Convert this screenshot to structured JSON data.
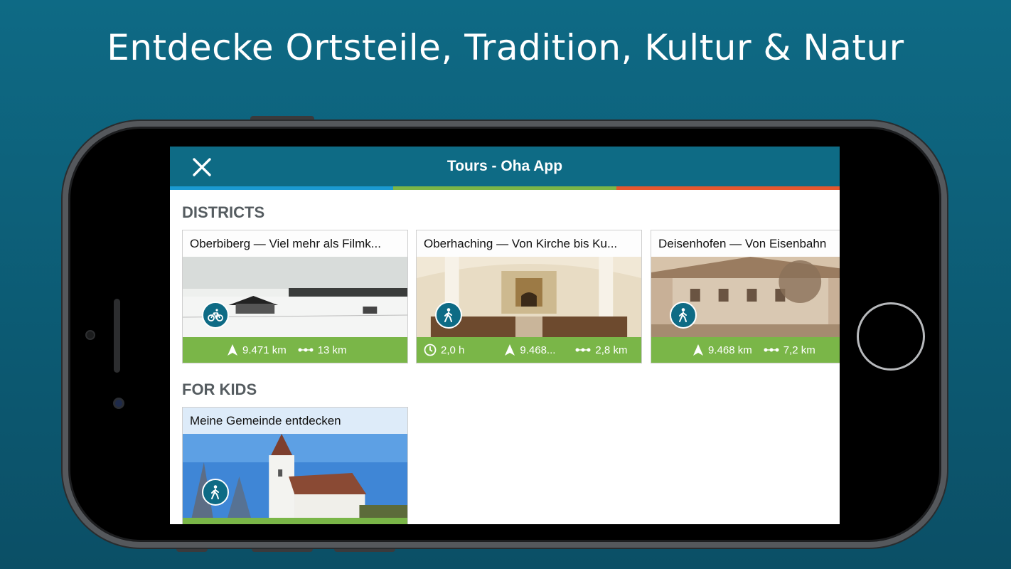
{
  "headline": "Entdecke Ortsteile, Tradition, Kultur & Natur",
  "appbar": {
    "title": "Tours - Oha App",
    "close_icon": "close-icon",
    "stripe_colors": [
      "#1b9ad1",
      "#7ab648",
      "#e4572e"
    ]
  },
  "colors": {
    "background": "#0b5e79",
    "appbar": "#0e6b85",
    "footer_green": "#7ab648"
  },
  "sections": {
    "districts": {
      "title": "DISTRICTS",
      "cards": [
        {
          "title": "Oberbiberg — Viel mehr als Filmk...",
          "mode_icon": "bicycle-icon",
          "elevation": "9.471 km",
          "distance": "13 km"
        },
        {
          "title": "Oberhaching — Von Kirche bis Ku...",
          "mode_icon": "walking-icon",
          "duration": "2,0 h",
          "elevation": "9.468...",
          "distance": "2,8 km"
        },
        {
          "title": "Deisenhofen — Von Eisenbahn",
          "mode_icon": "walking-icon",
          "elevation": "9.468 km",
          "distance": "7,2 km"
        }
      ]
    },
    "for_kids": {
      "title": "FOR KIDS",
      "cards": [
        {
          "title": "Meine Gemeinde entdecken",
          "mode_icon": "walking-icon"
        }
      ]
    }
  }
}
